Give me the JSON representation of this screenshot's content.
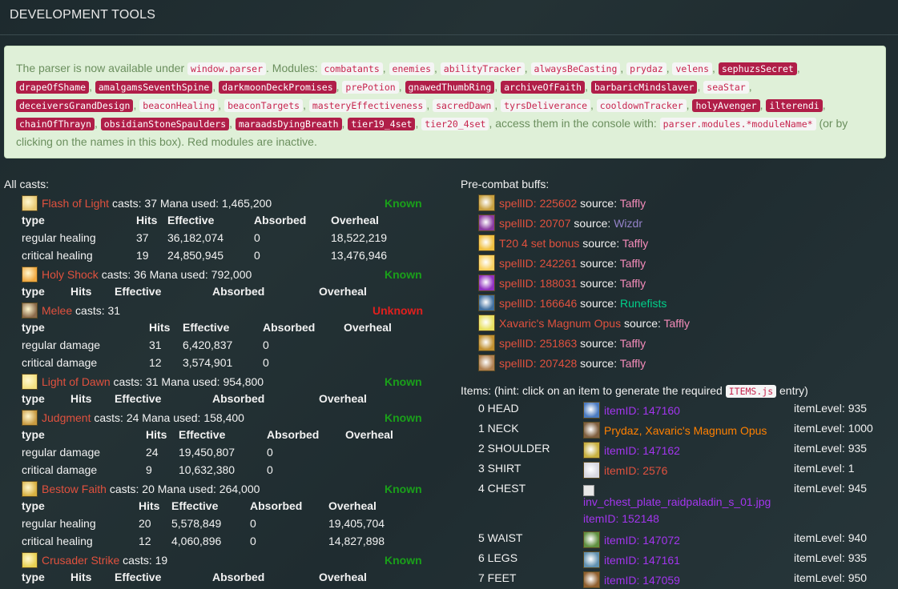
{
  "header": {
    "title": "DEVELOPMENT TOOLS"
  },
  "info": {
    "intro": "The parser is now available under ",
    "window_parser": "window.parser",
    "modules_label": ". Modules: ",
    "modules": [
      {
        "name": "combatants",
        "active": true
      },
      {
        "name": "enemies",
        "active": true
      },
      {
        "name": "abilityTracker",
        "active": true
      },
      {
        "name": "alwaysBeCasting",
        "active": true
      },
      {
        "name": "prydaz",
        "active": true
      },
      {
        "name": "velens",
        "active": true
      },
      {
        "name": "sephuzsSecret",
        "active": false
      },
      {
        "name": "drapeOfShame",
        "active": false
      },
      {
        "name": "amalgamsSeventhSpine",
        "active": false
      },
      {
        "name": "darkmoonDeckPromises",
        "active": false
      },
      {
        "name": "prePotion",
        "active": true
      },
      {
        "name": "gnawedThumbRing",
        "active": false
      },
      {
        "name": "archiveOfFaith",
        "active": false
      },
      {
        "name": "barbaricMindslaver",
        "active": false
      },
      {
        "name": "seaStar",
        "active": true
      },
      {
        "name": "deceiversGrandDesign",
        "active": false
      },
      {
        "name": "beaconHealing",
        "active": true
      },
      {
        "name": "beaconTargets",
        "active": true
      },
      {
        "name": "masteryEffectiveness",
        "active": true
      },
      {
        "name": "sacredDawn",
        "active": true
      },
      {
        "name": "tyrsDeliverance",
        "active": true
      },
      {
        "name": "cooldownTracker",
        "active": true
      },
      {
        "name": "holyAvenger",
        "active": false
      },
      {
        "name": "ilterendi",
        "active": false
      },
      {
        "name": "chainOfThrayn",
        "active": false
      },
      {
        "name": "obsidianStoneSpaulders",
        "active": false
      },
      {
        "name": "maraadsDyingBreath",
        "active": false
      },
      {
        "name": "tier19_4set",
        "active": false
      },
      {
        "name": "tier20_4set",
        "active": true
      }
    ],
    "access_text": ", access them in the console with: ",
    "console_code": "parser.modules.*moduleName*",
    "tail_text": " (or by clicking on the names in this box). Red modules are inactive."
  },
  "casts": {
    "title": "All casts:",
    "known_label": "Known",
    "unknown_label": "Unknown",
    "header_labels": {
      "type": "type",
      "hits": "Hits",
      "effective": "Effective",
      "absorbed": "Absorbed",
      "overheal": "Overheal"
    },
    "spells": [
      {
        "name": "Flash of Light",
        "info": " casts: 37 Mana used: 1,465,200",
        "status": "Known",
        "icon_color": "#e8c873",
        "rows": [
          [
            "regular healing",
            "37",
            "36,182,074",
            "0",
            "18,522,219"
          ],
          [
            "critical healing",
            "19",
            "24,850,945",
            "0",
            "13,476,946"
          ]
        ]
      },
      {
        "name": "Holy Shock",
        "info": " casts: 36 Mana used: 792,000",
        "status": "Known",
        "icon_color": "#f0a840",
        "rows": []
      },
      {
        "name": "Melee",
        "info": " casts: 31",
        "status": "Unknown",
        "icon_color": "#8a6a4a",
        "rows": [
          [
            "regular damage",
            "31",
            "6,420,837",
            "0",
            ""
          ],
          [
            "critical damage",
            "12",
            "3,574,901",
            "0",
            ""
          ]
        ]
      },
      {
        "name": "Light of Dawn",
        "info": " casts: 31 Mana used: 954,800",
        "status": "Known",
        "icon_color": "#f4e080",
        "rows": []
      },
      {
        "name": "Judgment",
        "info": " casts: 24 Mana used: 158,400",
        "status": "Known",
        "icon_color": "#c89a40",
        "rows": [
          [
            "regular damage",
            "24",
            "19,450,807",
            "0",
            ""
          ],
          [
            "critical damage",
            "9",
            "10,632,380",
            "0",
            ""
          ]
        ]
      },
      {
        "name": "Bestow Faith",
        "info": " casts: 20 Mana used: 264,000",
        "status": "Known",
        "icon_color": "#d8b040",
        "rows": [
          [
            "regular healing",
            "20",
            "5,578,849",
            "0",
            "19,405,704"
          ],
          [
            "critical healing",
            "12",
            "4,060,896",
            "0",
            "14,827,898"
          ]
        ]
      },
      {
        "name": "Crusader Strike",
        "info": " casts: 19",
        "status": "Known",
        "icon_color": "#e8d050",
        "rows": []
      }
    ]
  },
  "buffs": {
    "title": "Pre-combat buffs:",
    "source_label": " source: ",
    "items": [
      {
        "spell": "spellID: 225602",
        "source": "Taffly",
        "cls": "src-pal",
        "icon_color": "#c8a040"
      },
      {
        "spell": "spellID: 20707",
        "source": "Wizdr",
        "cls": "src-lock",
        "icon_color": "#8a3aa0"
      },
      {
        "spell": "T20 4 set bonus",
        "source": "Taffly",
        "cls": "src-pal",
        "icon_color": "#f0c040"
      },
      {
        "spell": "spellID: 242261",
        "source": "Taffly",
        "cls": "src-pal",
        "icon_color": "#f8d060"
      },
      {
        "spell": "spellID: 188031",
        "source": "Taffly",
        "cls": "src-pal",
        "icon_color": "#9030c0"
      },
      {
        "spell": "spellID: 166646",
        "source": "Runefists",
        "cls": "src-monk",
        "icon_color": "#4070a0"
      },
      {
        "spell": "Xavaric's Magnum Opus",
        "source": "Taffly",
        "cls": "src-pal",
        "icon_color": "#e8e060"
      },
      {
        "spell": "spellID: 251863",
        "source": "Taffly",
        "cls": "src-pal",
        "icon_color": "#c09030"
      },
      {
        "spell": "spellID: 207428",
        "source": "Taffly",
        "cls": "src-pal",
        "icon_color": "#b08050"
      }
    ]
  },
  "items": {
    "hint_prefix": "Items: (hint: click on an item to generate the required ",
    "hint_code": "ITEMS.js",
    "hint_suffix": " entry)",
    "ilvl_label": "itemLevel: ",
    "list": [
      {
        "slot": "0 HEAD",
        "name": "itemID: 147160",
        "quality": "epic",
        "ilvl": "935",
        "icon_color": "#4a7ac0"
      },
      {
        "slot": "1 NECK",
        "name": "Prydaz, Xavaric's Magnum Opus",
        "quality": "legend",
        "ilvl": "1000",
        "icon_color": "#806040"
      },
      {
        "slot": "2 SHOULDER",
        "name": "itemID: 147162",
        "quality": "epic",
        "ilvl": "935",
        "icon_color": "#c8b040"
      },
      {
        "slot": "3 SHIRT",
        "name": "itemID: 2576",
        "quality": "common",
        "ilvl": "1",
        "icon_color": "#d8d8e0"
      },
      {
        "slot": "4 CHEST",
        "name": "inv_chest_plate_raidpaladin_s_01.jpg",
        "name2": "itemID: 152148",
        "quality": "epic",
        "ilvl": "945",
        "icon_color": ""
      },
      {
        "slot": "5 WAIST",
        "name": "itemID: 147072",
        "quality": "epic",
        "ilvl": "940",
        "icon_color": "#609040"
      },
      {
        "slot": "6 LEGS",
        "name": "itemID: 147161",
        "quality": "epic",
        "ilvl": "935",
        "icon_color": "#6090b0"
      },
      {
        "slot": "7 FEET",
        "name": "itemID: 147059",
        "quality": "epic",
        "ilvl": "950",
        "icon_color": "#906030"
      }
    ]
  }
}
